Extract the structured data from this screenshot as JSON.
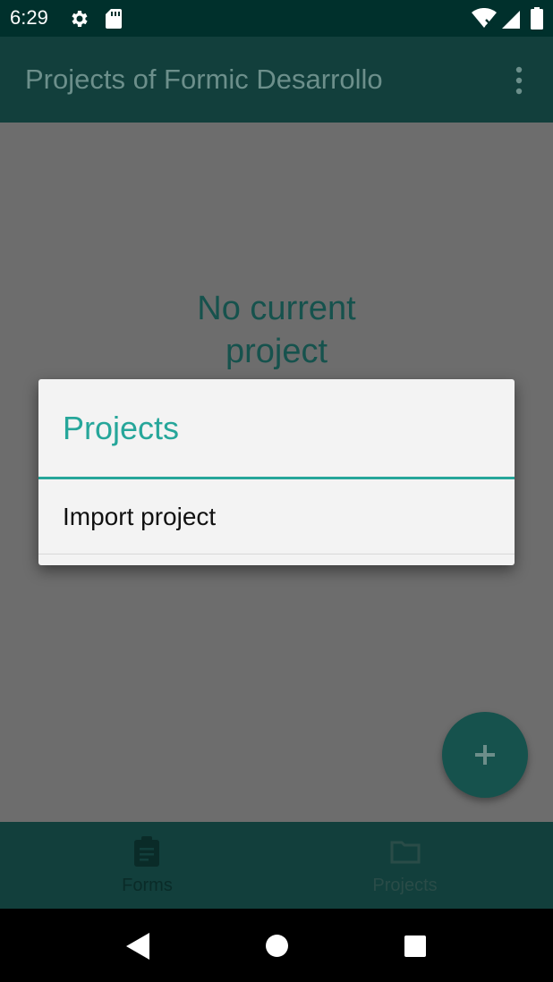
{
  "status_bar": {
    "time": "6:29",
    "icons": [
      "gear-icon",
      "sd-card-icon",
      "wifi-icon",
      "signal-icon",
      "battery-icon"
    ]
  },
  "app_bar": {
    "title": "Projects of Formic Desarrollo",
    "overflow_icon": "more-vert-icon"
  },
  "content": {
    "empty_message_line1": "No current",
    "empty_message_line2": "project"
  },
  "fab": {
    "icon": "plus-icon"
  },
  "bottom_nav": {
    "items": [
      {
        "label": "Forms",
        "icon": "clipboard-icon"
      },
      {
        "label": "Projects",
        "icon": "folder-icon"
      }
    ]
  },
  "dialog": {
    "title": "Projects",
    "items": [
      {
        "label": "Import project"
      }
    ]
  },
  "colors": {
    "accent": "#26a69a",
    "app_bar": "#123f3c",
    "status_bar": "#00302c",
    "scrim_content": "#6d6d6d",
    "dialog_bg": "#f3f3f3"
  }
}
